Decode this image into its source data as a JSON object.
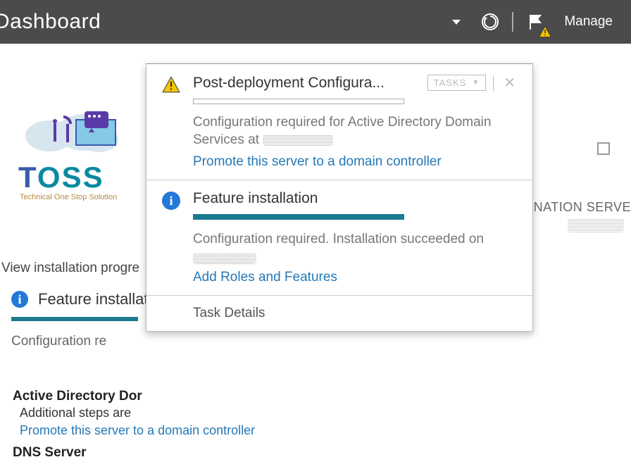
{
  "topbar": {
    "title": "Dashboard",
    "manage": "Manage"
  },
  "popup": {
    "section1": {
      "title": "Post-deployment Configura...",
      "tasks_btn": "TASKS",
      "desc_pre": "Configuration required for Active Directory Domain Services at ",
      "link": "Promote this server to a domain controller"
    },
    "section2": {
      "title": "Feature installation",
      "desc": "Configuration required. Installation succeeded on",
      "link": "Add Roles and Features"
    },
    "task_details": "Task Details"
  },
  "left_col": {
    "view_progress": "View installation progre",
    "feature_title": "Feature installati",
    "conf_req": "Configuration re"
  },
  "right_side": {
    "dest_label": "TINATION SERVE"
  },
  "bottom": {
    "ad_title": "Active Directory Dor",
    "ad_desc": "Additional steps are",
    "ad_link": "Promote this server to a domain controller",
    "dns_title": "DNS Server"
  },
  "logo": {
    "main": "TOSS",
    "sub": "Technical One Stop Solution"
  }
}
